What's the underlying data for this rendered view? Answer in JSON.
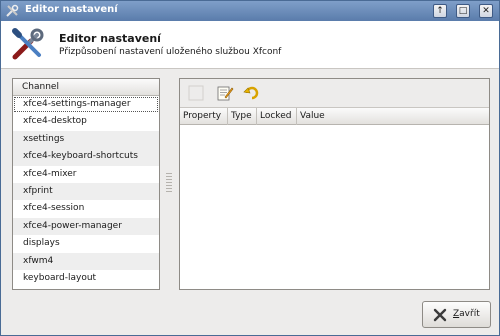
{
  "window": {
    "title": "Editor nastavení",
    "buttons": [
      {
        "name": "up",
        "glyph": "↑"
      },
      {
        "name": "maximize",
        "glyph": "□"
      },
      {
        "name": "close",
        "glyph": "✕"
      }
    ]
  },
  "header": {
    "title": "Editor nastavení",
    "subtitle": "Přizpůsobení nastavení uloženého službou Xfconf",
    "icon": "tools-icon"
  },
  "channels": {
    "column_header": "Channel",
    "items": [
      "xfce4-settings-manager",
      "xfce4-desktop",
      "xsettings",
      "xfce4-keyboard-shortcuts",
      "xfce4-mixer",
      "xfprint",
      "xfce4-session",
      "xfce4-power-manager",
      "displays",
      "xfwm4",
      "keyboard-layout"
    ],
    "selected_index": 0
  },
  "toolbar": {
    "tools": [
      "new-property-icon",
      "edit-property-icon",
      "revert-property-icon"
    ]
  },
  "properties": {
    "columns": [
      "Property",
      "Type",
      "Locked",
      "Value"
    ]
  },
  "footer": {
    "close_label_accel": "Z",
    "close_label_rest": "avřít"
  },
  "colors": {
    "titlebar": "#6a8cbb",
    "window_bg": "#edeceb",
    "list_alt_row": "#eeeeee"
  }
}
